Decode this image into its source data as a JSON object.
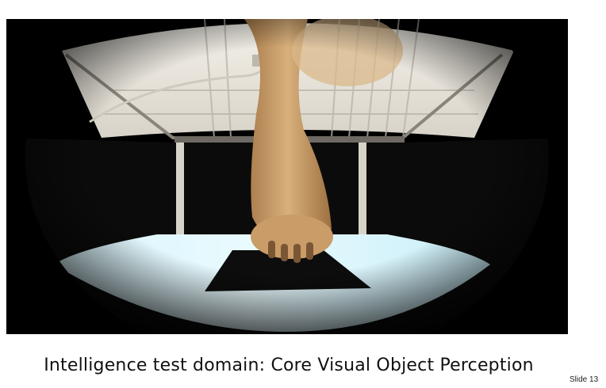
{
  "slide": {
    "caption": "Intelligence test domain: Core Visual Object Perception",
    "slide_number": "Slide 13"
  },
  "photo": {
    "subject": "monkey-arm-touching-screen-photo"
  }
}
